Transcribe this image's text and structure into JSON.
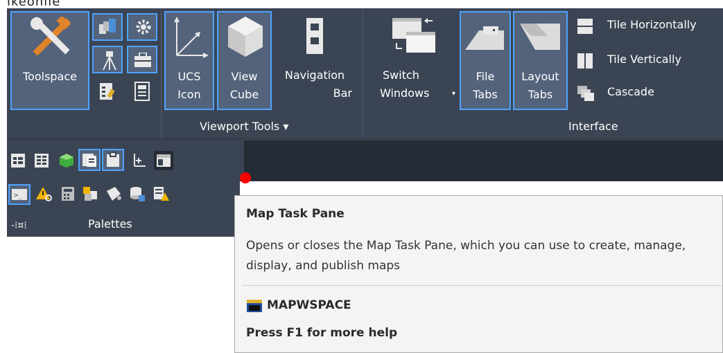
{
  "window_title_fragment": "ikeonile",
  "ribbon": {
    "toolspace": {
      "label": "Toolspace"
    },
    "viewport_tools": {
      "panel_title": "Viewport Tools",
      "ucs_icon": {
        "line1": "UCS",
        "line2": "Icon"
      },
      "view_cube": {
        "line1": "View",
        "line2": "Cube"
      },
      "navigation_bar": {
        "line1": "Navigation",
        "line2": "Bar"
      }
    },
    "interface": {
      "panel_title": "Interface",
      "switch_windows": {
        "line1": "Switch",
        "line2": "Windows"
      },
      "file_tabs": {
        "line1": "File",
        "line2": "Tabs"
      },
      "layout_tabs": {
        "line1": "Layout",
        "line2": "Tabs"
      },
      "tile_horizontally": "Tile Horizontally",
      "tile_vertically": "Tile Vertically",
      "cascade": "Cascade"
    }
  },
  "palettes": {
    "panel_title": "Palettes"
  },
  "tooltip": {
    "title": "Map Task Pane",
    "description": "Opens or closes the Map Task Pane, which you can use to create, manage, display, and publish maps",
    "command": "MAPWSPACE",
    "help": "Press F1 for more help"
  },
  "colors": {
    "ribbon_bg": "#3b4453",
    "highlight_border": "#4fa3ff",
    "dark_band": "#262c36",
    "tooltip_bg": "#f4f4f4",
    "cursor_dot": "#ff0000"
  }
}
